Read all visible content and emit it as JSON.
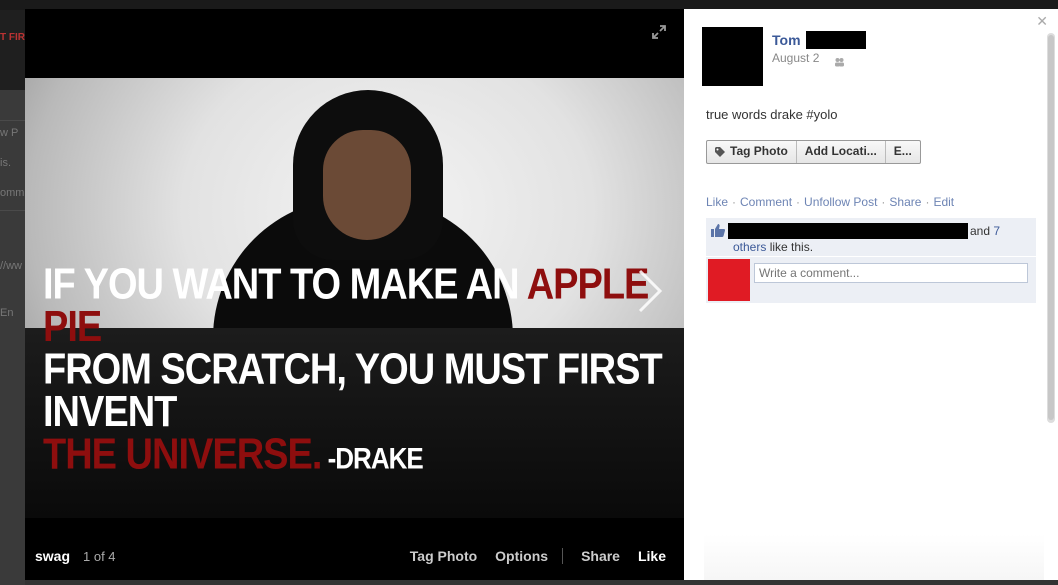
{
  "background": {
    "fragments": [
      "T FIR",
      "w P",
      "is.",
      "omm",
      "//ww",
      "En"
    ]
  },
  "photo_viewer": {
    "album_name": "swag",
    "counter": "1 of 4",
    "actions": {
      "tag_photo": "Tag Photo",
      "options": "Options",
      "share": "Share",
      "like": "Like"
    },
    "quote": {
      "line1_white": "IF YOU WANT TO MAKE AN ",
      "line1_red": "APPLE PIE",
      "line2_white": "FROM SCRATCH, YOU MUST FIRST INVENT",
      "line3_red": "THE UNIVERSE.",
      "line3_attr": " -DRAKE"
    }
  },
  "post": {
    "author": "Tom",
    "date": "August 2",
    "caption": "true words drake #yolo",
    "buttons": {
      "tag_photo": "Tag Photo",
      "add_location": "Add Locati...",
      "edit": "E..."
    },
    "links": [
      "Like",
      "Comment",
      "Unfollow Post",
      "Share",
      "Edit"
    ],
    "likes": {
      "and_text": "and",
      "count": "7",
      "others": "others",
      "suffix": " like this."
    },
    "comment_placeholder": "Write a comment..."
  },
  "colors": {
    "link": "#3b5998",
    "light_link": "#6d84b4",
    "comment_avatar": "#e01b24",
    "quote_red": "#8e0e0e"
  }
}
